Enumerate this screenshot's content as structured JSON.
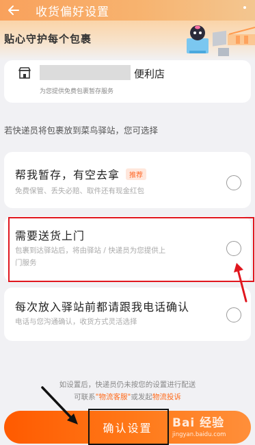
{
  "header": {
    "title": "收货偏好设置"
  },
  "hero": {
    "slogan": "贴心守护每个包裹"
  },
  "store": {
    "name_suffix": "便利店",
    "subtitle": "为您提供免费包裹暂存服务"
  },
  "section_hint": "若快递员将包裹放到菜鸟驿站，您可选择",
  "options": [
    {
      "title": "帮我暂存，有空去拿",
      "badge": "推荐",
      "description": "免费保管、丢失必赔、取件还有现金红包",
      "selected": false
    },
    {
      "title": "需要送货上门",
      "description_line1": "包裹到达驿站后，将由驿站 / 快递员为您提供上",
      "description_line2": "门服务",
      "selected": false
    },
    {
      "title": "每次放入驿站前都请跟我电话确认",
      "description": "电话与您沟通确认，收货方式灵活选择",
      "selected": false
    }
  ],
  "footer": {
    "line1": "如设置后，快递员仍未按您的设置进行配送",
    "line2_prefix": "可联系",
    "link1": "\"物流客服\"",
    "line2_middle": "或发起",
    "link2": "物流投诉"
  },
  "confirm": {
    "label": "确认设置"
  },
  "watermark": {
    "main": "Bai 经验",
    "sub": "jingyan.baidu.com"
  },
  "colors": {
    "accent": "#ff6a1a",
    "highlight_box": "#e0161e"
  }
}
